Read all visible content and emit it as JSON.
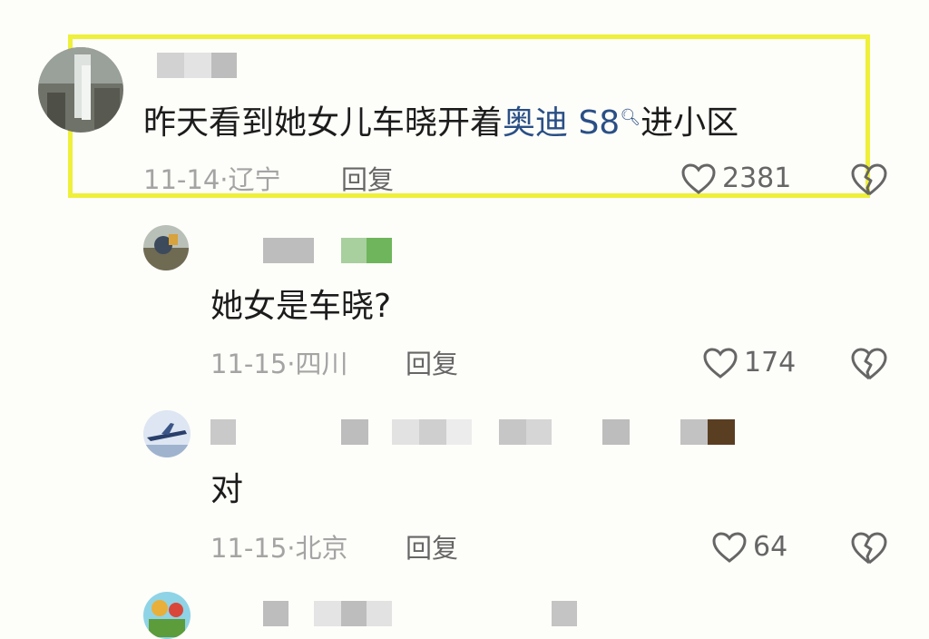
{
  "comments": [
    {
      "text_plain": "昨天看到她女儿车晓开着",
      "link": "奥迪 S8",
      "text_after": "进小区",
      "date": "11-14",
      "location": "辽宁",
      "reply": "回复",
      "likes": "2381"
    },
    {
      "text": "她女是车晓?",
      "date": "11-15",
      "location": "四川",
      "reply": "回复",
      "likes": "174"
    },
    {
      "text": "对",
      "date": "11-15",
      "location": "北京",
      "reply": "回复",
      "likes": "64"
    }
  ],
  "icons": {
    "like": "heart-outline-icon",
    "dislike": "broken-heart-icon",
    "link_search": "search-icon"
  },
  "colors": {
    "highlight": "#eef03a",
    "link": "#2a4f86",
    "meta": "#a4a4a4"
  }
}
